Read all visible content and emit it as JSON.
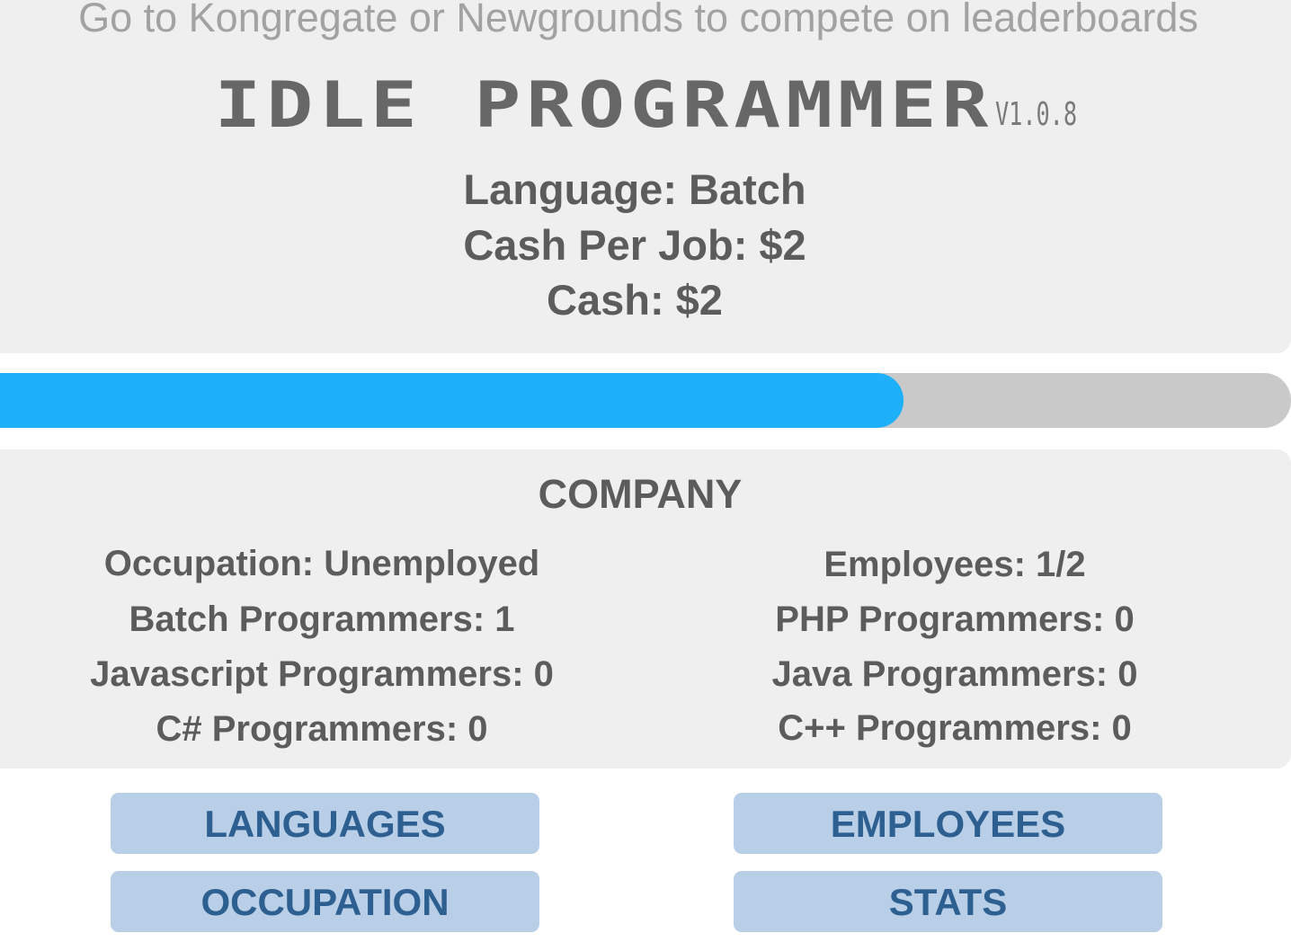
{
  "promo_text": "Go to Kongregate or Newgrounds to compete on leaderboards",
  "title": "IDLE PROGRAMMER",
  "version": "V1.0.8",
  "stats": {
    "language": "Language: Batch",
    "cash_per_job": "Cash Per Job: $2",
    "cash": "Cash: $2"
  },
  "progress": {
    "fraction": 0.7,
    "fill_color": "#1fb0fa",
    "track_color": "#c9c9c9"
  },
  "company": {
    "heading": "COMPANY",
    "left_rows": [
      "Occupation: Unemployed",
      "Batch Programmers: 1",
      "Javascript Programmers: 0",
      "C# Programmers: 0"
    ],
    "right_rows": [
      "Employees: 1/2",
      "PHP Programmers: 0",
      "Java Programmers: 0",
      "C++ Programmers: 0"
    ]
  },
  "buttons": {
    "languages": "LANGUAGES",
    "employees": "EMPLOYEES",
    "occupation": "OCCUPATION",
    "stats": "STATS"
  }
}
